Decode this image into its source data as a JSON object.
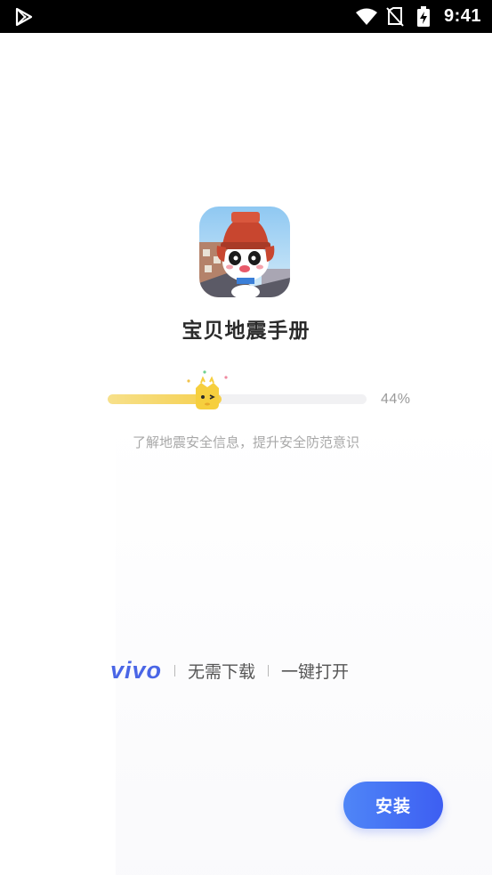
{
  "status_bar": {
    "time": "9:41",
    "icons": [
      "play-store-icon",
      "wifi-icon",
      "no-sim-icon",
      "battery-charging-icon"
    ]
  },
  "app": {
    "name": "宝贝地震手册",
    "icon": "baby-panda-earthquake-app-icon"
  },
  "download": {
    "progress": 0.44,
    "percent_text": "44%",
    "tagline": "了解地震安全信息，提升安全防范意识",
    "mascot_icon": "crown-mascot-icon"
  },
  "brand": {
    "logo": "vivo",
    "feature_1": "无需下载",
    "feature_2": "一键打开"
  },
  "install_button": {
    "label": "安装"
  },
  "colors": {
    "accent": "#3d5ef2",
    "progress": "#f5cf4c",
    "brand": "#4a66e6"
  }
}
